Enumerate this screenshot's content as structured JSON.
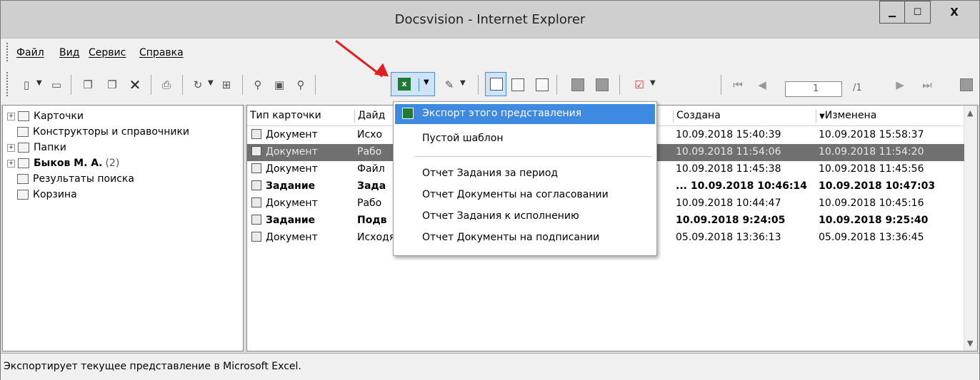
{
  "window": {
    "title": "Docsvision - Internet Explorer",
    "min_icon": "minimize-icon",
    "max_icon": "maximize-icon",
    "close_label": "X"
  },
  "menu": [
    "Файл",
    "Вид",
    "Сервис",
    "Справка"
  ],
  "pager": {
    "current": "1",
    "total": "/1"
  },
  "tree": [
    {
      "label": "Карточки",
      "count": "",
      "expandable": true
    },
    {
      "label": "Конструкторы и справочники",
      "count": "",
      "expandable": false
    },
    {
      "label": "Папки",
      "count": "",
      "expandable": true
    },
    {
      "label": "Быков М. А.",
      "count": "(2)",
      "expandable": true,
      "bold": true
    },
    {
      "label": "Результаты поиска",
      "count": "",
      "expandable": false
    },
    {
      "label": "Корзина",
      "count": "",
      "expandable": false
    }
  ],
  "columns": [
    "Тип карточки",
    "Дайд",
    "Создана",
    "Изменена"
  ],
  "rows": [
    {
      "type": "Документ",
      "name": "Исхо",
      "created": "10.09.2018 15:40:39",
      "modified": "10.09.2018 15:58:37",
      "selected": false,
      "bold": false
    },
    {
      "type": "Документ",
      "name": "Рабо",
      "created": "10.09.2018 11:54:06",
      "modified": "10.09.2018 11:54:20",
      "selected": true,
      "bold": false
    },
    {
      "type": "Документ",
      "name": "Файл",
      "created": "10.09.2018 11:45:38",
      "modified": "10.09.2018 11:45:56",
      "selected": false,
      "bold": false
    },
    {
      "type": "Задание",
      "name": "Зада",
      "created": "... 10.09.2018 10:46:14",
      "modified": "10.09.2018 10:47:03",
      "selected": false,
      "bold": true
    },
    {
      "type": "Документ",
      "name": "Рабо",
      "created": "10.09.2018 10:44:47",
      "modified": "10.09.2018 10:45:16",
      "selected": false,
      "bold": false
    },
    {
      "type": "Задание",
      "name": "Подв",
      "created": "10.09.2018 9:24:05",
      "modified": "10.09.2018 9:25:40",
      "selected": false,
      "bold": true
    },
    {
      "type": "Документ",
      "name": "Исходящий Заключение экспертизы по договору И...",
      "created": "05.09.2018 13:36:13",
      "modified": "05.09.2018 13:36:45",
      "selected": false,
      "bold": false
    }
  ],
  "dropdown": {
    "items": [
      "Экспорт этого представления",
      "Пустой шаблон"
    ],
    "reports": [
      "Отчет Задания за период",
      "Отчет Документы на согласовании",
      "Отчет Задания к исполнению",
      "Отчет Документы на подписании"
    ]
  },
  "status": "Экспортирует текущее представление в Microsoft Excel.",
  "colors": {
    "accent": "#3d8ae0",
    "selection": "#707070",
    "annotation_arrow": "#e02020"
  }
}
